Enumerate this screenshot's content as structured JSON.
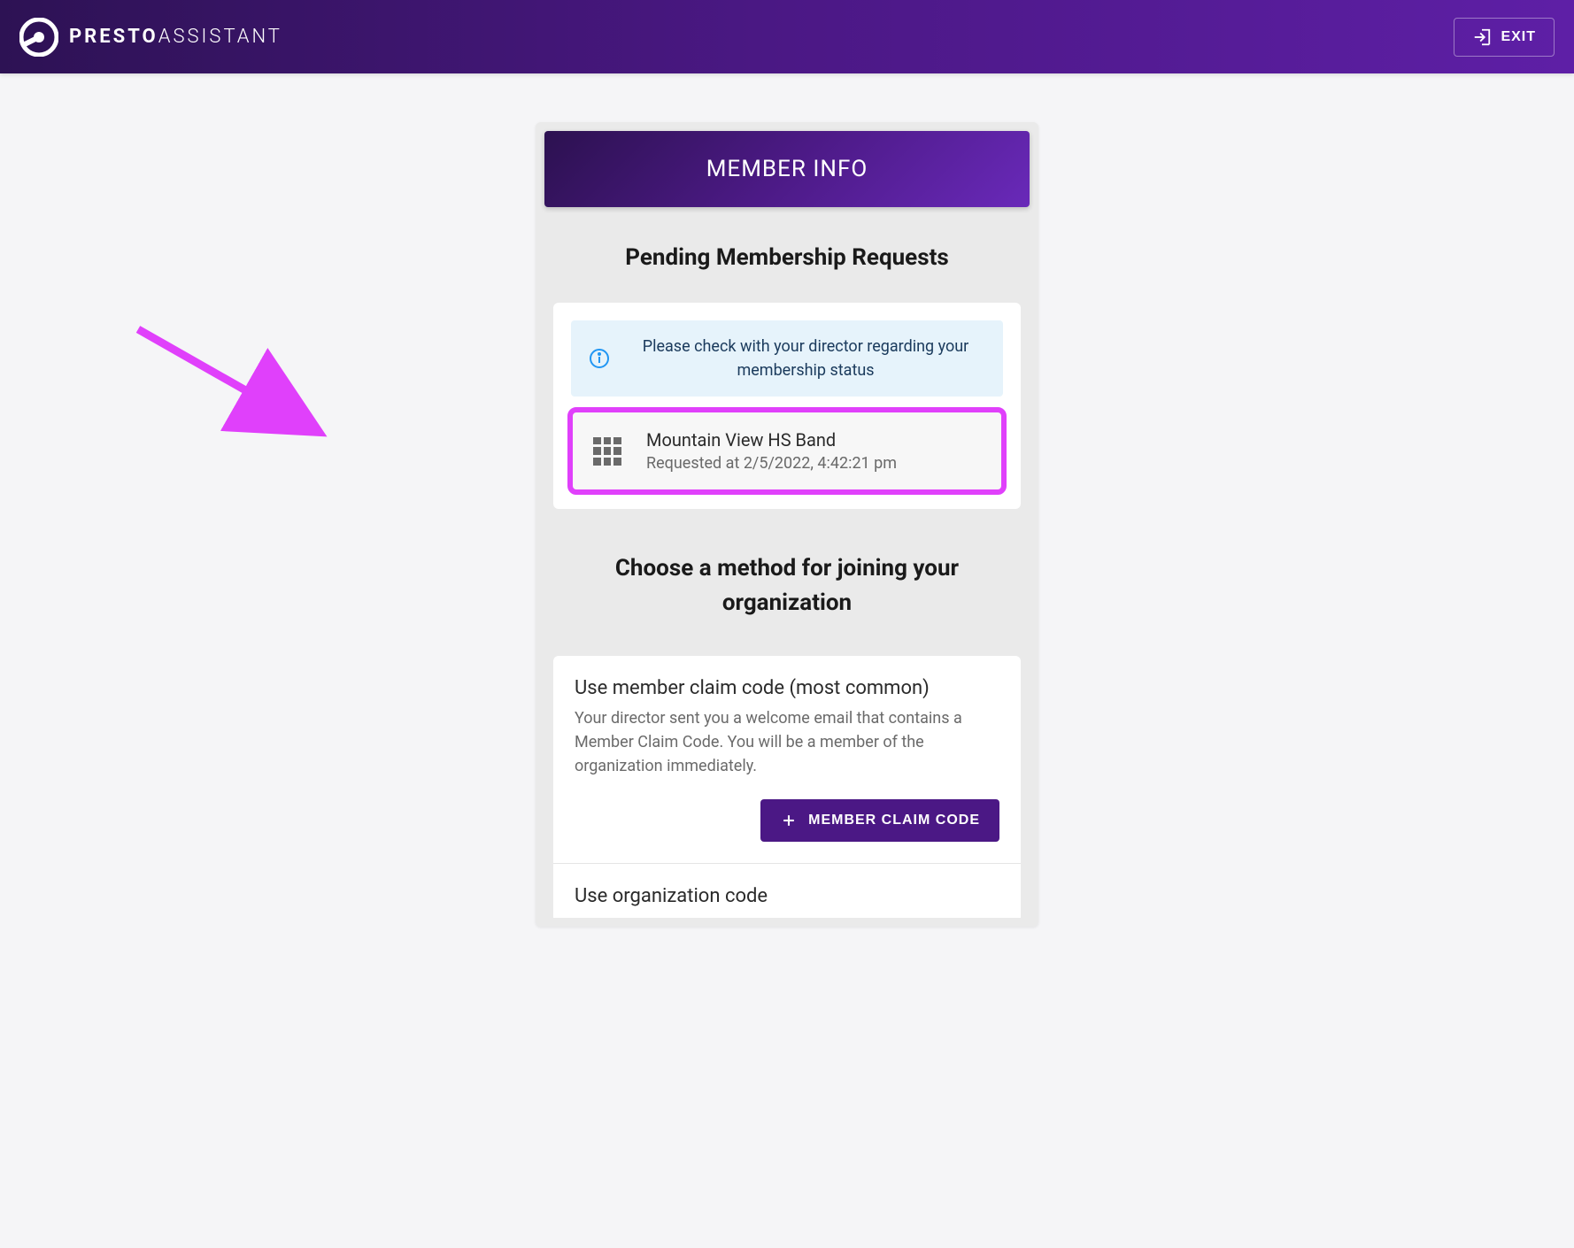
{
  "header": {
    "brand_bold": "PRESTO",
    "brand_light": "ASSISTANT",
    "exit_label": "EXIT"
  },
  "card": {
    "title": "MEMBER INFO"
  },
  "pending": {
    "title": "Pending Membership Requests",
    "info_text": "Please check with your director regarding your membership status",
    "org": {
      "name": "Mountain View HS Band",
      "requested_at": "Requested at 2/5/2022, 4:42:21 pm"
    }
  },
  "join": {
    "title": "Choose a method for joining your organization",
    "claim_code": {
      "heading": "Use member claim code (most common)",
      "desc": "Your director sent you a welcome email that contains a Member Claim Code. You will be a member of the organization immediately.",
      "button": "MEMBER CLAIM CODE"
    },
    "org_code": {
      "heading": "Use organization code"
    }
  }
}
